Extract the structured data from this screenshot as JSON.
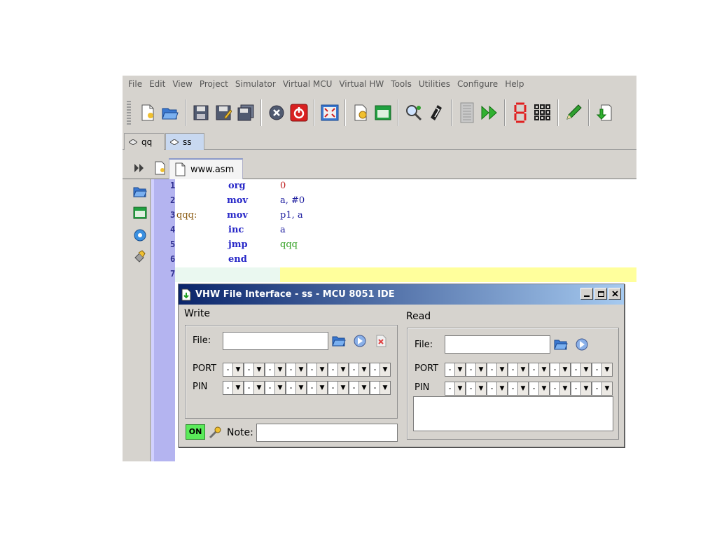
{
  "menu": [
    "File",
    "Edit",
    "View",
    "Project",
    "Simulator",
    "Virtual MCU",
    "Virtual HW",
    "Tools",
    "Utilities",
    "Configure",
    "Help"
  ],
  "toolbar": {
    "buttons": [
      "new-file-icon",
      "open-folder-icon",
      "save-icon",
      "save-as-icon",
      "save-all-icon",
      "close-icon",
      "power-icon",
      "fullscreen-icon",
      "new-project-icon",
      "open-project-icon",
      "search-replace-icon",
      "compile-icon",
      "memory-icon",
      "run-icon",
      "seven-segment-icon",
      "keypad-icon",
      "pencil-icon",
      "download-icon"
    ]
  },
  "project_tabs": [
    "qq",
    "ss"
  ],
  "file_tab": "www.asm",
  "editor": {
    "line_numbers": [
      "1",
      "2",
      "3",
      "4",
      "5",
      "6",
      "7"
    ],
    "lines": [
      {
        "label": "",
        "op": "org",
        "arg": "0"
      },
      {
        "label": "",
        "op": "mov",
        "arg": "a, #0"
      },
      {
        "label": "qqq:",
        "op": "mov",
        "arg": "p1, a"
      },
      {
        "label": "",
        "op": "inc",
        "arg": "a"
      },
      {
        "label": "",
        "op": "jmp",
        "arg": "qqq"
      },
      {
        "label": "",
        "op": "end",
        "arg": ""
      },
      {
        "label": "",
        "op": "",
        "arg": ""
      }
    ]
  },
  "dialog": {
    "title": "VHW File Interface - ss - MCU 8051 IDE",
    "write": {
      "label": "Write",
      "file_label": "File:",
      "file_value": "",
      "port_label": "PORT",
      "pin_label": "PIN",
      "combo_value": "-"
    },
    "read": {
      "label": "Read",
      "file_label": "File:",
      "file_value": "",
      "port_label": "PORT",
      "pin_label": "PIN",
      "combo_value": "-"
    },
    "on_label": "ON",
    "note_label": "Note:",
    "note_value": ""
  },
  "colors": {
    "keyword": "#2828c8",
    "label": "#8a5a10",
    "number": "#c02020",
    "identifier": "#30a020",
    "gutter": "#b4b4f0",
    "current_line": "#ffff9c",
    "titlebar": "#0a246a",
    "on_badge": "#5aea5a"
  }
}
